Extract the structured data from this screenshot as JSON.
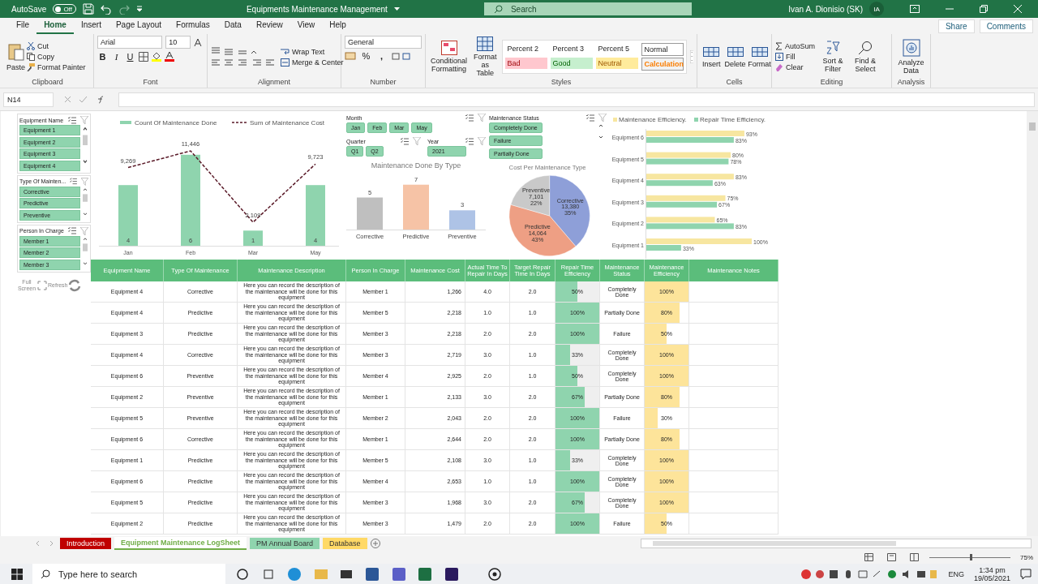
{
  "title_bar": {
    "autosave_label": "AutoSave",
    "autosave_state": "Off",
    "autosave_on": false,
    "title": "Equipments Maintenance Management",
    "search_placeholder": "Search",
    "user": "Ivan A. Dionisio (SK)",
    "initials": "IA"
  },
  "ribbon_tabs": [
    {
      "label": "File",
      "selected": false
    },
    {
      "label": "Home",
      "selected": true
    },
    {
      "label": "Insert",
      "selected": false
    },
    {
      "label": "Page Layout",
      "selected": false
    },
    {
      "label": "Formulas",
      "selected": false
    },
    {
      "label": "Data",
      "selected": false
    },
    {
      "label": "Review",
      "selected": false
    },
    {
      "label": "View",
      "selected": false
    },
    {
      "label": "Help",
      "selected": false
    }
  ],
  "share": "Share",
  "comments": "Comments",
  "clipboard": {
    "label": "Clipboard",
    "paste": "Paste",
    "cut": "Cut",
    "copy": "Copy",
    "format_painter": "Format Painter"
  },
  "font": {
    "label": "Font",
    "family": "Arial",
    "size": "10",
    "bold": "B",
    "italic": "I",
    "underline": "U"
  },
  "alignment": {
    "label": "Alignment",
    "wrap": "Wrap Text",
    "merge": "Merge & Center"
  },
  "number": {
    "label": "Number",
    "format": "General",
    "percent": "%",
    "comma": ","
  },
  "styles": {
    "label": "Styles",
    "conditional": "Conditional Formatting",
    "format_table": "Format as Table",
    "cells": [
      {
        "label": "Percent 2",
        "kind": "plain"
      },
      {
        "label": "Percent 3",
        "kind": "plain"
      },
      {
        "label": "Percent 5",
        "kind": "plain"
      },
      {
        "label": "Normal",
        "kind": "normal"
      },
      {
        "label": "Bad",
        "kind": "bad"
      },
      {
        "label": "Good",
        "kind": "good"
      },
      {
        "label": "Neutral",
        "kind": "neutral"
      },
      {
        "label": "Calculation",
        "kind": "calculation"
      }
    ]
  },
  "cells": {
    "label": "Cells",
    "buttons": [
      "Insert",
      "Delete",
      "Format"
    ]
  },
  "editing": {
    "label": "Editing",
    "autosum": "AutoSum",
    "fill": "Fill",
    "clear": "Clear",
    "sort": "Sort & Filter",
    "find": "Find & Select"
  },
  "analysis": {
    "label": "Analysis",
    "analyze": "Analyze Data"
  },
  "name_box": "N14",
  "slicers_left": [
    {
      "title": "Equipment Name",
      "items": [
        {
          "label": "Equipment 1",
          "selected": true
        },
        {
          "label": "Equipment 2",
          "selected": true
        },
        {
          "label": "Equipment 3",
          "selected": true
        },
        {
          "label": "Equipment 4",
          "selected": true
        }
      ]
    },
    {
      "title": "Type Of Mainten...",
      "items": [
        {
          "label": "Corrective",
          "selected": true
        },
        {
          "label": "Predictive",
          "selected": true
        },
        {
          "label": "Preventive",
          "selected": true
        }
      ]
    },
    {
      "title": "Person In Charge",
      "items": [
        {
          "label": "Member 1",
          "selected": true
        },
        {
          "label": "Member 2",
          "selected": true
        },
        {
          "label": "Member 3",
          "selected": true
        }
      ]
    }
  ],
  "dashboard_buttons": {
    "full_screen": "Full Screen",
    "refresh": "Refresh"
  },
  "month_slicer": {
    "title": "Month",
    "items": [
      {
        "label": "Jan",
        "selected": true
      },
      {
        "label": "Feb",
        "selected": true
      },
      {
        "label": "Mar",
        "selected": true
      },
      {
        "label": "May",
        "selected": true
      }
    ]
  },
  "quarter_slicer": {
    "title": "Quarter",
    "items": [
      {
        "label": "Q1",
        "selected": true
      },
      {
        "label": "Q2",
        "selected": true
      }
    ]
  },
  "year_slicer": {
    "title": "Year",
    "items": [
      {
        "label": "2021",
        "selected": true
      }
    ]
  },
  "status_slicer": {
    "title": "Maintenance Status",
    "items": [
      {
        "label": "Completely Done",
        "selected": true
      },
      {
        "label": "Failure",
        "selected": true
      },
      {
        "label": "Partially Done",
        "selected": true
      }
    ]
  },
  "monthly_chart": {
    "chart_data": {
      "type": "bar",
      "categories": [
        "Jan",
        "Feb",
        "Mar",
        "May"
      ],
      "data_labels": true,
      "legend": "top",
      "series": [
        {
          "name": "Count Of Maintenance Done",
          "color": "#8fd4ae",
          "values": [
            4,
            6,
            1,
            4
          ],
          "value_labels": [
            "4",
            "6",
            "1",
            "4"
          ]
        }
      ]
    }
  },
  "cost_trend_chart": {
    "chart_data": {
      "type": "line",
      "data_labels": true,
      "legend": "top",
      "series": [
        {
          "name": "Sum of Maintenance Cost",
          "color": "#5a1a28",
          "line_style": "dashed",
          "values": [
            9269,
            11446,
            2109,
            9723
          ],
          "value_labels": [
            "9,269",
            "11,446",
            "2,109",
            "9,723"
          ]
        }
      ]
    }
  },
  "type_chart": {
    "chart_data": {
      "type": "bar",
      "title": "Maintenance Done By Type",
      "categories": [
        "Corrective",
        "Predictive",
        "Preventive"
      ],
      "data_labels": true,
      "series": [
        {
          "values": [
            5,
            7,
            3
          ],
          "value_labels": [
            "5",
            "7",
            "3"
          ]
        }
      ]
    },
    "bars": [
      {
        "color": "#bfbfbf"
      },
      {
        "color": "#f6c3a6"
      },
      {
        "color": "#aec3e6"
      }
    ]
  },
  "cost_chart": {
    "chart_data": {
      "type": "pie",
      "title": "Cost Per Maintenance Type",
      "categories": [
        "Corrective",
        "Predictive",
        "Preventive"
      ],
      "data_labels": true,
      "series": [
        {
          "values": [
            13380,
            14064,
            7101
          ],
          "value_labels": [
            "13,380",
            "14,064",
            "7,101"
          ]
        }
      ]
    },
    "slices": [
      {
        "color": "#8e9fd8",
        "percent": "35%"
      },
      {
        "color": "#ee9f84",
        "percent": "43%"
      },
      {
        "color": "#c9c9c9",
        "percent": "22%"
      }
    ]
  },
  "efficiency_chart": {
    "chart_data": {
      "type": "bar",
      "orientation": "horizontal",
      "legend": "top",
      "categories": [
        "Equipment 6",
        "Equipment 5",
        "Equipment 4",
        "Equipment 3",
        "Equipment 2",
        "Equipment 1"
      ],
      "data_labels": true,
      "series": [
        {
          "name": "Maintenance Efficiency.",
          "color": "#f7e6a0",
          "values": [
            93,
            80,
            83,
            75,
            65,
            100
          ],
          "value_labels": [
            "93%",
            "80%",
            "83%",
            "75%",
            "65%",
            "100%"
          ]
        },
        {
          "name": "Repair Time Efficiency.",
          "color": "#8fd4ae",
          "values": [
            83,
            78,
            63,
            67,
            83,
            33
          ],
          "value_labels": [
            "83%",
            "78%",
            "63%",
            "67%",
            "83%",
            "33%"
          ]
        }
      ]
    }
  },
  "table": {
    "columns": [
      "Equipment Name",
      "Type Of Maintenance",
      "Maintenance Description",
      "Person In Charge",
      "Maintenance Cost",
      "Actual Time To Repair In Days",
      "Target Repair Time In Days",
      "Repair Time Efficiency",
      "Maintenance Status",
      "Maintenance Efficiency",
      "Maintenance Notes"
    ],
    "rows": [
      {
        "equipment": "Equipment 4",
        "type": "Corrective",
        "description": "Here you can record the description of the maintenance will be done for this equipment",
        "person": "Member 1",
        "cost": "1,266",
        "actual": "4.0",
        "target": "2.0",
        "repair_eff": {
          "label": "50%",
          "level": 0.5
        },
        "status": "Completely Done",
        "maint_eff": {
          "label": "100%",
          "level": 1
        }
      },
      {
        "equipment": "Equipment 4",
        "type": "Predictive",
        "description": "Here you can record the description of the maintenance will be done for this equipment",
        "person": "Member 5",
        "cost": "2,218",
        "actual": "1.0",
        "target": "1.0",
        "repair_eff": {
          "label": "100%",
          "level": 1
        },
        "status": "Partially Done",
        "maint_eff": {
          "label": "80%",
          "level": 0.8
        }
      },
      {
        "equipment": "Equipment 3",
        "type": "Predictive",
        "description": "Here you can record the description of the maintenance will be done for this equipment",
        "person": "Member 3",
        "cost": "2,218",
        "actual": "2.0",
        "target": "2.0",
        "repair_eff": {
          "label": "100%",
          "level": 1
        },
        "status": "Failure",
        "maint_eff": {
          "label": "50%",
          "level": 0.5
        }
      },
      {
        "equipment": "Equipment 4",
        "type": "Corrective",
        "description": "Here you can record the description of the maintenance will be done for this equipment",
        "person": "Member 3",
        "cost": "2,719",
        "actual": "3.0",
        "target": "1.0",
        "repair_eff": {
          "label": "33%",
          "level": 0.33
        },
        "status": "Completely Done",
        "maint_eff": {
          "label": "100%",
          "level": 1
        }
      },
      {
        "equipment": "Equipment 6",
        "type": "Preventive",
        "description": "Here you can record the description of the maintenance will be done for this equipment",
        "person": "Member 4",
        "cost": "2,925",
        "actual": "2.0",
        "target": "1.0",
        "repair_eff": {
          "label": "50%",
          "level": 0.5
        },
        "status": "Completely Done",
        "maint_eff": {
          "label": "100%",
          "level": 1
        }
      },
      {
        "equipment": "Equipment 2",
        "type": "Preventive",
        "description": "Here you can record the description of the maintenance will be done for this equipment",
        "person": "Member 1",
        "cost": "2,133",
        "actual": "3.0",
        "target": "2.0",
        "repair_eff": {
          "label": "67%",
          "level": 0.67
        },
        "status": "Partially Done",
        "maint_eff": {
          "label": "80%",
          "level": 0.8
        }
      },
      {
        "equipment": "Equipment 5",
        "type": "Preventive",
        "description": "Here you can record the description of the maintenance will be done for this equipment",
        "person": "Member 2",
        "cost": "2,043",
        "actual": "2.0",
        "target": "2.0",
        "repair_eff": {
          "label": "100%",
          "level": 1
        },
        "status": "Failure",
        "maint_eff": {
          "label": "30%",
          "level": 0.3
        }
      },
      {
        "equipment": "Equipment 6",
        "type": "Corrective",
        "description": "Here you can record the description of the maintenance will be done for this equipment",
        "person": "Member 1",
        "cost": "2,644",
        "actual": "2.0",
        "target": "2.0",
        "repair_eff": {
          "label": "100%",
          "level": 1
        },
        "status": "Partially Done",
        "maint_eff": {
          "label": "80%",
          "level": 0.8
        }
      },
      {
        "equipment": "Equipment 1",
        "type": "Predictive",
        "description": "Here you can record the description of the maintenance will be done for this equipment",
        "person": "Member 5",
        "cost": "2,108",
        "actual": "3.0",
        "target": "1.0",
        "repair_eff": {
          "label": "33%",
          "level": 0.33
        },
        "status": "Completely Done",
        "maint_eff": {
          "label": "100%",
          "level": 1
        }
      },
      {
        "equipment": "Equipment 6",
        "type": "Predictive",
        "description": "Here you can record the description of the maintenance will be done for this equipment",
        "person": "Member 4",
        "cost": "2,653",
        "actual": "1.0",
        "target": "1.0",
        "repair_eff": {
          "label": "100%",
          "level": 1
        },
        "status": "Completely Done",
        "maint_eff": {
          "label": "100%",
          "level": 1
        }
      },
      {
        "equipment": "Equipment 5",
        "type": "Predictive",
        "description": "Here you can record the description of the maintenance will be done for this equipment",
        "person": "Member 3",
        "cost": "1,968",
        "actual": "3.0",
        "target": "2.0",
        "repair_eff": {
          "label": "67%",
          "level": 0.67
        },
        "status": "Completely Done",
        "maint_eff": {
          "label": "100%",
          "level": 1
        }
      },
      {
        "equipment": "Equipment 2",
        "type": "Predictive",
        "description": "Here you can record the description of the maintenance will be done for this equipment",
        "person": "Member 3",
        "cost": "1,479",
        "actual": "2.0",
        "target": "2.0",
        "repair_eff": {
          "label": "100%",
          "level": 1
        },
        "status": "Failure",
        "maint_eff": {
          "label": "50%",
          "level": 0.5
        }
      }
    ]
  },
  "sheet_tabs": [
    {
      "label": "Introduction",
      "color": "#c00000",
      "selected": false
    },
    {
      "label": "Equipment Maintenance LogSheet",
      "color": "#70ad47",
      "selected": true
    },
    {
      "label": "PM Annual Board",
      "color": "#8fd4ae",
      "selected": false
    },
    {
      "label": "Database",
      "color": "#ffd966",
      "selected": false
    }
  ],
  "status_bar": {
    "zoom": "75%",
    "zoom_slider": {
      "level": 0.5
    }
  },
  "taskbar": {
    "search_placeholder": "Type here to search",
    "language": "ENG",
    "time": "1:34 pm",
    "date": "19/05/2021"
  }
}
